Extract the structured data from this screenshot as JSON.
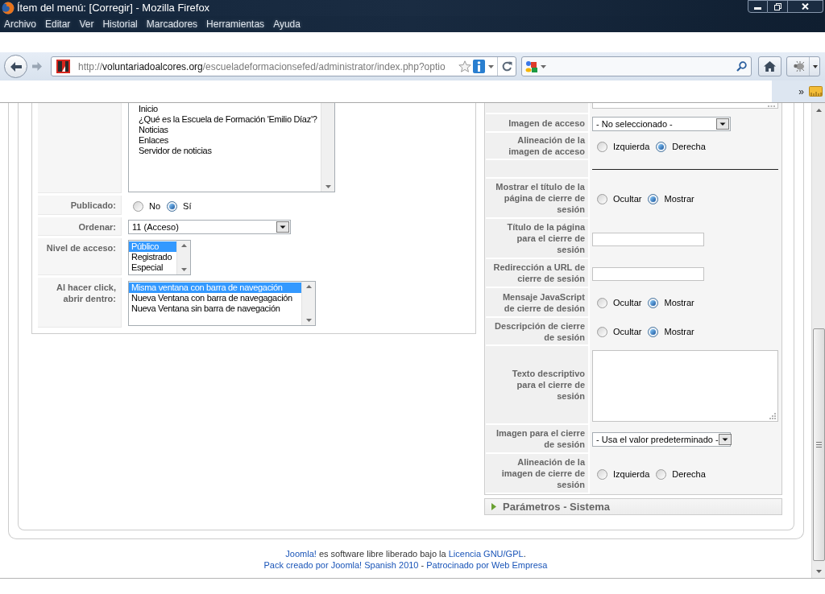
{
  "window": {
    "title": "Ítem del menú: [Corregir] - Mozilla Firefox"
  },
  "menu_bar": {
    "items": [
      "Archivo",
      "Editar",
      "Ver",
      "Historial",
      "Marcadores",
      "Herramientas",
      "Ayuda"
    ]
  },
  "address_bar": {
    "scheme": "http://",
    "host": "voluntariadoalcores.org",
    "path": "/escueladeformacionsefed/administrator/index.php?optio"
  },
  "bookmarks_toolbar": {
    "overflow": "»"
  },
  "left_form": {
    "rows": [
      {
        "kind": "listbox",
        "items": [
          {
            "label": "Inicio",
            "selected": false
          },
          {
            "label": "¿Qué es la Escuela de Formación 'Emilio Díaz'?",
            "selected": false
          },
          {
            "label": "Noticias",
            "selected": false
          },
          {
            "label": "Enlaces",
            "selected": false
          },
          {
            "label": "Servidor de noticias",
            "selected": false
          }
        ]
      },
      {
        "kind": "radio",
        "label": "Publicado:",
        "options": [
          {
            "label": "No",
            "selected": false
          },
          {
            "label": "Sí",
            "selected": true
          }
        ]
      },
      {
        "kind": "select",
        "label": "Ordenar:",
        "value": "11 (Acceso)"
      },
      {
        "kind": "listbox",
        "label": "Nivel de acceso:",
        "items": [
          {
            "label": "Público",
            "selected": true
          },
          {
            "label": "Registrado",
            "selected": false
          },
          {
            "label": "Especial",
            "selected": false
          }
        ]
      },
      {
        "kind": "listbox",
        "label": "Al hacer click, abrir dentro:",
        "items": [
          {
            "label": "Misma ventana con barra de navegación",
            "selected": true
          },
          {
            "label": "Nueva Ventana con barra de navegagación",
            "selected": false
          },
          {
            "label": "Nueva Ventana sin barra de navegación",
            "selected": false
          }
        ]
      }
    ]
  },
  "right_params": {
    "rows": [
      {
        "kind": "textarea"
      },
      {
        "kind": "select",
        "label": "Imagen de acceso",
        "value": "- No seleccionado -"
      },
      {
        "kind": "radio",
        "label": "Alineación de la imagen de acceso",
        "options": [
          {
            "label": "Izquierda",
            "selected": false
          },
          {
            "label": "Derecha",
            "selected": true
          }
        ]
      },
      {
        "kind": "separator"
      },
      {
        "kind": "radio",
        "label": "Mostrar el título de la página de cierre de sesión",
        "options": [
          {
            "label": "Ocultar",
            "selected": false
          },
          {
            "label": "Mostrar",
            "selected": true
          }
        ]
      },
      {
        "kind": "text",
        "label": "Título de la página para el cierre de sesión"
      },
      {
        "kind": "text",
        "label": "Redirección a URL de cierre de sesión"
      },
      {
        "kind": "radio",
        "label": "Mensaje JavaScript de cierre de desión",
        "options": [
          {
            "label": "Ocultar",
            "selected": false
          },
          {
            "label": "Mostrar",
            "selected": true
          }
        ]
      },
      {
        "kind": "radio",
        "label": "Descripción de cierre de sesión",
        "options": [
          {
            "label": "Ocultar",
            "selected": false
          },
          {
            "label": "Mostrar",
            "selected": true
          }
        ]
      },
      {
        "kind": "textarea",
        "label": "Texto descriptivo para el cierre de sesión"
      },
      {
        "kind": "select",
        "label": "Imagen para el cierre de sesión",
        "value": "- Usa el valor predeterminado -"
      },
      {
        "kind": "radio",
        "label": "Alineación de la imagen de cierre de sesión",
        "options": [
          {
            "label": "Izquierda",
            "selected": false
          },
          {
            "label": "Derecha",
            "selected": false
          }
        ]
      }
    ]
  },
  "collapsed_panel": {
    "title": "Parámetros - Sistema",
    "expanded": false
  },
  "footer": {
    "lines": [
      {
        "parts": [
          {
            "text": "Joomla!",
            "link": true
          },
          {
            "text": " es software libre liberado bajo la ",
            "link": false
          },
          {
            "text": "Licencia GNU/GPL",
            "link": true
          },
          {
            "text": ".",
            "link": false
          }
        ]
      },
      {
        "parts": [
          {
            "text": "Pack creado por Joomla! Spanish 2010",
            "link": true
          },
          {
            "text": " - ",
            "link": false
          },
          {
            "text": "Patrocinado por Web Empresa",
            "link": true
          }
        ]
      }
    ]
  }
}
